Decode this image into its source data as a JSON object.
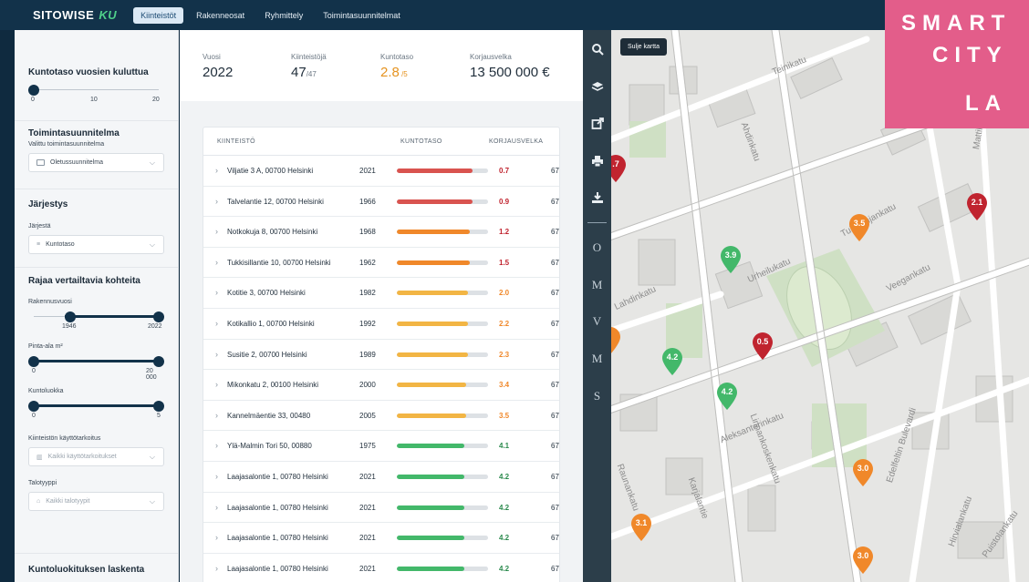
{
  "nav": {
    "brand": "SITOWISE",
    "brand_suffix": "KU",
    "tabs": [
      {
        "label": "Kiinteistöt",
        "active": true
      },
      {
        "label": "Rakenneosat",
        "active": false
      },
      {
        "label": "Ryhmittely",
        "active": false
      },
      {
        "label": "Toimintasuunnitelmat",
        "active": false
      }
    ]
  },
  "sidebar": {
    "condition_over_time": {
      "title": "Kuntotaso vuosien kuluttua",
      "ticks": [
        "0",
        "10",
        "20"
      ],
      "value": 0,
      "min": 0,
      "max": 20
    },
    "action_plan": {
      "title": "Toimintasuunnitelma",
      "label": "Valittu toimintasuunnitelma",
      "selected": "Oletussuunnitelma"
    },
    "ordering": {
      "title": "Järjestys",
      "label": "Järjestä",
      "selected": "Kuntotaso"
    },
    "filters": {
      "title": "Rajaa vertailtavia kohteita",
      "year": {
        "label": "Rakennusvuosi",
        "min_label": "1946",
        "max_label": "2022",
        "from": 1946,
        "to": 2022,
        "min": 1946,
        "max": 2022
      },
      "area": {
        "label": "Pinta-ala m²",
        "min_label": "0",
        "max_label": "20 000",
        "from": 0,
        "to": 20000,
        "min": 0,
        "max": 20000
      },
      "class": {
        "label": "Kuntoluokka",
        "min_label": "0",
        "max_label": "5",
        "from": 0,
        "to": 5,
        "min": 0,
        "max": 5
      },
      "usage": {
        "label": "Kiinteistön käyttötarkoitus",
        "placeholder": "Kaikki käyttötarkoitukset"
      },
      "house_type": {
        "label": "Talotyyppi",
        "placeholder": "Kaikki talotyypit"
      }
    },
    "calculation": {
      "title": "Kuntoluokituksen laskenta"
    }
  },
  "stats": [
    {
      "label": "Vuosi",
      "value": "2022",
      "sub": ""
    },
    {
      "label": "Kiinteistöjä",
      "value": "47",
      "sub": "/47"
    },
    {
      "label": "Kuntotaso",
      "value": "2.8",
      "sub": " /5"
    },
    {
      "label": "Korjausvelka",
      "value": "13 500 000 €",
      "sub": ""
    }
  ],
  "table": {
    "headers": {
      "property": "KIINTEISTÖ",
      "condition": "KUNTOTASO",
      "debt": "KORJAUSVELKA"
    },
    "rows": [
      {
        "address": "Viljatie 3 A, 00700 Helsinki",
        "year": "2021",
        "score": "0.7",
        "debt": "67"
      },
      {
        "address": "Talvelantie 12, 00700 Helsinki",
        "year": "1966",
        "score": "0.9",
        "debt": "67"
      },
      {
        "address": "Notkokuja 8, 00700 Helsinki",
        "year": "1968",
        "score": "1.2",
        "debt": "67"
      },
      {
        "address": "Tukkisillantie 10, 00700 Helsinki",
        "year": "1962",
        "score": "1.5",
        "debt": "67"
      },
      {
        "address": "Kotitie 3, 00700 Helsinki",
        "year": "1982",
        "score": "2.0",
        "debt": "67"
      },
      {
        "address": "Kotikallio 1, 00700 Helsinki",
        "year": "1992",
        "score": "2.2",
        "debt": "67"
      },
      {
        "address": "Susitie 2, 00700 Helsinki",
        "year": "1989",
        "score": "2.3",
        "debt": "67"
      },
      {
        "address": "Mikonkatu 2, 00100 Helsinki",
        "year": "2000",
        "score": "3.4",
        "debt": "67"
      },
      {
        "address": "Kannelmäentie 33, 00480",
        "year": "2005",
        "score": "3.5",
        "debt": "67"
      },
      {
        "address": "Ylä-Malmin Tori 50, 00880",
        "year": "1975",
        "score": "4.1",
        "debt": "67"
      },
      {
        "address": "Laajasalontie 1, 00780 Helsinki",
        "year": "2021",
        "score": "4.2",
        "debt": "67"
      },
      {
        "address": "Laajasalontie 1, 00780 Helsinki",
        "year": "2021",
        "score": "4.2",
        "debt": "67"
      },
      {
        "address": "Laajasalontie 1, 00780 Helsinki",
        "year": "2021",
        "score": "4.2",
        "debt": "67"
      },
      {
        "address": "Laajasalontie 1, 00780 Helsinki",
        "year": "2021",
        "score": "4.2",
        "debt": "67"
      }
    ]
  },
  "colors": {
    "red": "#d9534f",
    "orange": "#f0882a",
    "yellow": "#f2b544",
    "green": "#43b86a",
    "darkred": "#c0242f",
    "navy": "#12324a",
    "pink": "#e35d8a"
  },
  "map_tools": {
    "icons": [
      "search-icon",
      "layers-icon",
      "share-icon",
      "print-icon",
      "download-icon"
    ],
    "letters": [
      "O",
      "M",
      "V",
      "M",
      "S"
    ]
  },
  "map": {
    "close_label": "Sulje kartta",
    "streets": [
      "Teinikatu",
      "Aleksanterinkatu",
      "Tullipohjankatu",
      "Mattilan",
      "Urheilukatu",
      "Veegankatu",
      "Ahdinkatu",
      "Lahdinkatu",
      "Linnankoskenkatu",
      "Karjalantie",
      "Raunankatu",
      "Edelfeltin Bulevardi",
      "Hirvialankatu",
      "Puistolankatu"
    ],
    "markers": [
      {
        "label": ".7",
        "level": "darkred"
      },
      {
        "label": "2.1",
        "level": "darkred"
      },
      {
        "label": "3.5",
        "level": "orange"
      },
      {
        "label": "3.9",
        "level": "green"
      },
      {
        "label": "0.5",
        "level": "darkred"
      },
      {
        "label": "4.2",
        "level": "green"
      },
      {
        "label": "4.2",
        "level": "green"
      },
      {
        "label": "3.0",
        "level": "orange"
      },
      {
        "label": "3.1",
        "level": "orange"
      },
      {
        "label": "3.0",
        "level": "orange"
      },
      {
        "label": "",
        "level": "orange"
      }
    ]
  },
  "logo": {
    "line1": "SMART",
    "line2": "CITY",
    "line3": "LA"
  }
}
